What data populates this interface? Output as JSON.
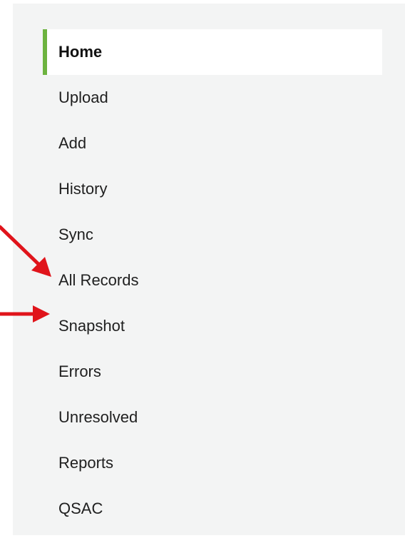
{
  "sidebar": {
    "accent_color": "#6db33f",
    "items": [
      {
        "label": "Home",
        "active": true
      },
      {
        "label": "Upload"
      },
      {
        "label": "Add"
      },
      {
        "label": "History"
      },
      {
        "label": "Sync"
      },
      {
        "label": "All Records"
      },
      {
        "label": "Snapshot"
      },
      {
        "label": "Errors"
      },
      {
        "label": "Unresolved"
      },
      {
        "label": "Reports"
      },
      {
        "label": "QSAC"
      }
    ]
  },
  "annotations": {
    "arrow_color": "#e0141b",
    "arrows": [
      {
        "points_to": "All Records"
      },
      {
        "points_to": "Snapshot"
      }
    ]
  }
}
